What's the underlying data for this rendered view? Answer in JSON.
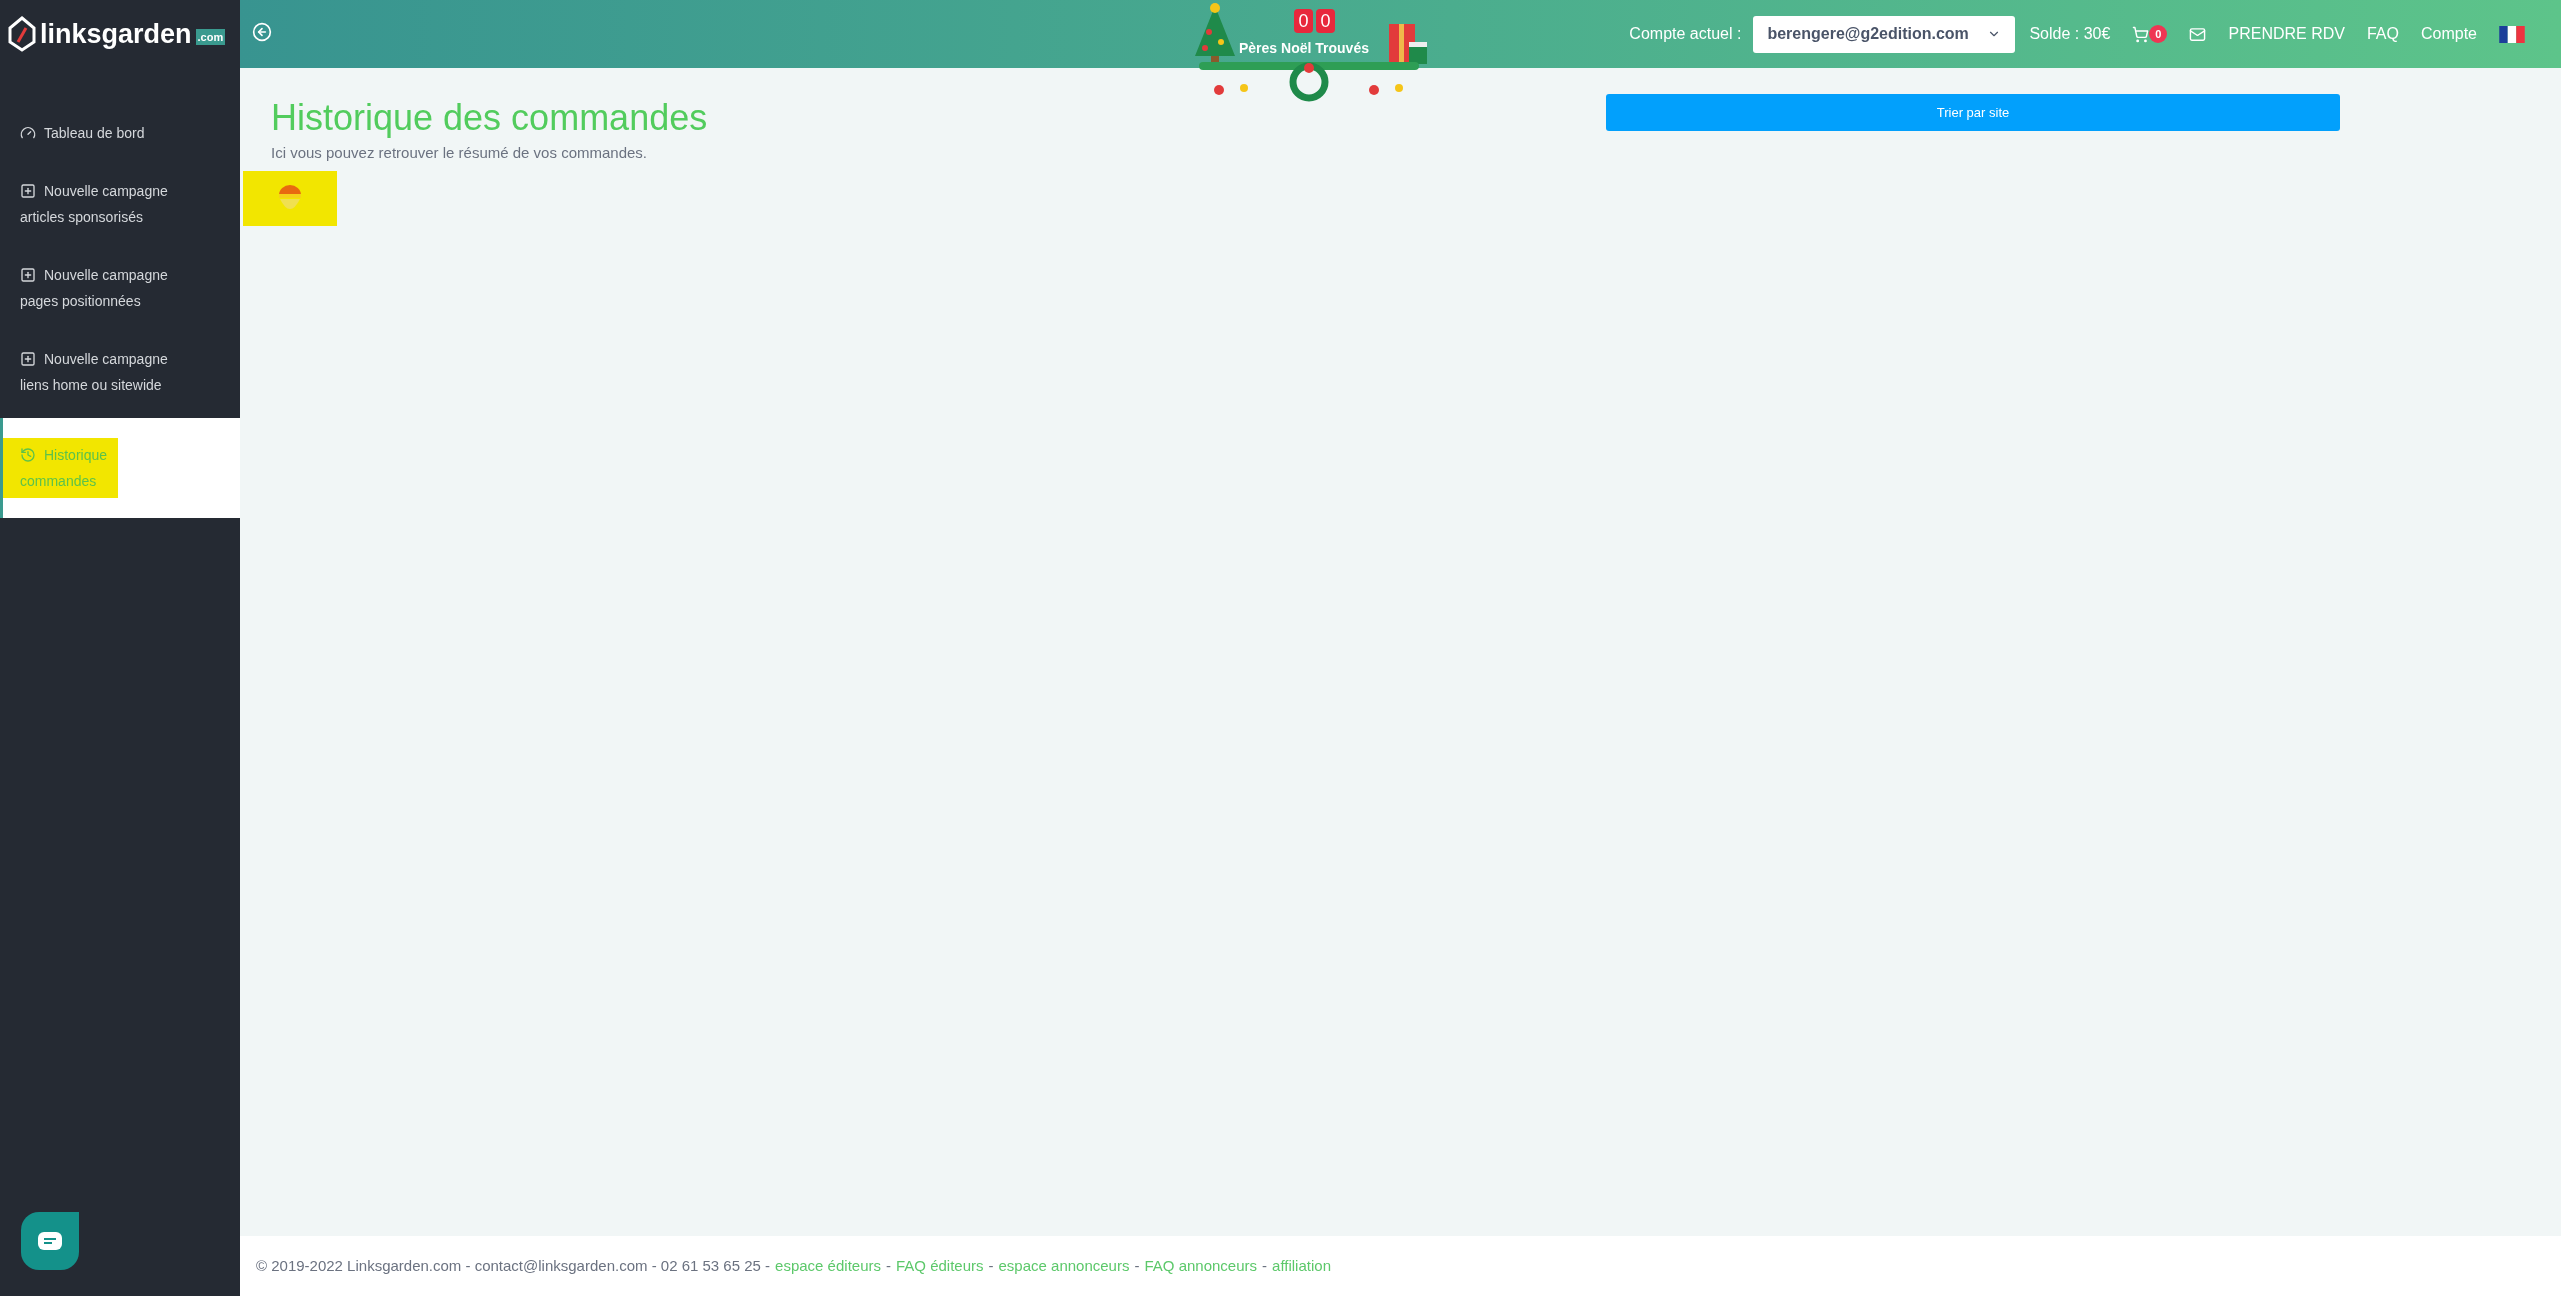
{
  "logo": {
    "name": "linksgarden",
    "suffix": ".com"
  },
  "sidebar": {
    "items": [
      {
        "kind": "dashboard",
        "label": "Tableau de bord",
        "selected": false
      },
      {
        "kind": "plus",
        "label": "Nouvelle campagne articles sponsorisés",
        "selected": false
      },
      {
        "kind": "plus",
        "label": "Nouvelle campagne pages positionnées",
        "selected": false
      },
      {
        "kind": "plus",
        "label": "Nouvelle campagne liens home ou sitewide",
        "selected": false
      },
      {
        "kind": "history",
        "label": "Historique commandes",
        "selected": true
      }
    ]
  },
  "header": {
    "counter": [
      "0",
      "0"
    ],
    "counter_label": "Pères Noël Trouvés",
    "account_label": "Compte actuel :",
    "account_value": "berengere@g2edition.com",
    "balance": "Solde : 30€",
    "cart_count": "0",
    "links": [
      "PRENDRE RDV",
      "FAQ",
      "Compte"
    ]
  },
  "page": {
    "title": "Historique des commandes",
    "subtitle": "Ici vous pouvez retrouver le résumé de vos commandes.",
    "sort_button": "Trier par site"
  },
  "footer": [
    {
      "kind": "text",
      "text": "© 2019-2022 Linksgarden.com - contact@linksgarden.com - 02 61 53 65 25 -"
    },
    {
      "kind": "link",
      "text": "espace éditeurs"
    },
    {
      "kind": "text",
      "text": "-"
    },
    {
      "kind": "link",
      "text": "FAQ éditeurs"
    },
    {
      "kind": "text",
      "text": "-"
    },
    {
      "kind": "link",
      "text": "espace annonceurs"
    },
    {
      "kind": "text",
      "text": "-"
    },
    {
      "kind": "link",
      "text": "FAQ annonceurs"
    },
    {
      "kind": "text",
      "text": "-"
    },
    {
      "kind": "link",
      "text": "affiliation"
    }
  ]
}
